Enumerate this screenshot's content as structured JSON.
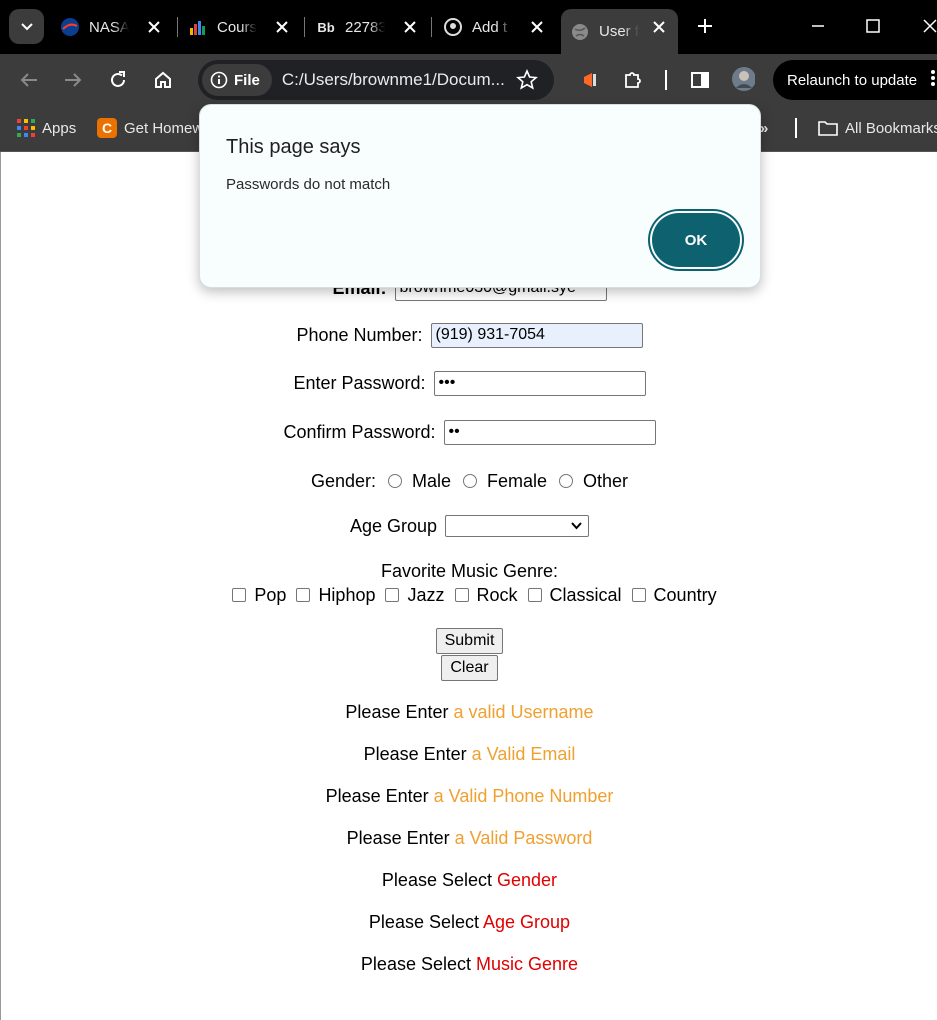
{
  "browser": {
    "tabs": [
      {
        "title": "NASA"
      },
      {
        "title": "Cours"
      },
      {
        "title": "22783"
      },
      {
        "title": "Add t"
      },
      {
        "title": "User f"
      }
    ],
    "tab3_icon_text": "Bb",
    "address": {
      "chip_label": "File",
      "url": "C:/Users/brownme1/Docum..."
    },
    "relaunch_label": "Relaunch to update",
    "bookmarks": {
      "apps": "Apps",
      "get_homework": "Get Homew",
      "all_bookmarks": "All Bookmarks",
      "more": "»"
    }
  },
  "dialog": {
    "title": "This page says",
    "message": "Passwords do not match",
    "ok_label": "OK"
  },
  "form": {
    "email_label": "Email:",
    "email_value": "brownme030@gmail.sye",
    "phone_label": "Phone Number:",
    "phone_value": "(919) 931-7054",
    "password_label": "Enter Password:",
    "password_value": "•••",
    "confirm_label": "Confirm Password:",
    "confirm_value": "••",
    "gender_label": "Gender:",
    "gender_options": [
      "Male",
      "Female",
      "Other"
    ],
    "age_label": "Age Group",
    "age_value": "",
    "genre_label": "Favorite Music Genre:",
    "genre_options": [
      "Pop",
      "Hiphop",
      "Jazz",
      "Rock",
      "Classical",
      "Country"
    ],
    "submit_label": "Submit",
    "clear_label": "Clear"
  },
  "messages": [
    {
      "prefix": "Please Enter",
      "highlight": "a valid Username"
    },
    {
      "prefix": "Please Enter",
      "highlight": "a Valid Email"
    },
    {
      "prefix": "Please Enter",
      "highlight": "a Valid Phone Number"
    },
    {
      "prefix": "Please Enter",
      "highlight": "a Valid Password"
    },
    {
      "prefix": "Please Select",
      "highlight": "Gender"
    },
    {
      "prefix": "Please Select",
      "highlight": "Age Group"
    },
    {
      "prefix": "Please Select",
      "highlight": "Music Genre"
    }
  ],
  "colors": {
    "warning_orange": "#f0a030",
    "error_red": "#e00000",
    "dialog_ok": "#0e6270"
  }
}
